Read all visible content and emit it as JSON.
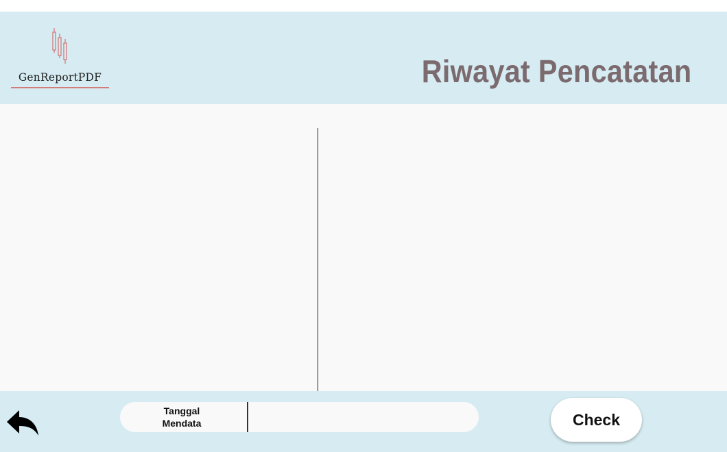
{
  "header": {
    "logo_text": "GenReportPDF",
    "logo_icon": "candlestick-chart-icon",
    "title": "Riwayat Pencatatan"
  },
  "footer": {
    "back_icon": "back-arrow-icon",
    "date_label_line1": "Tanggal",
    "date_label_line2": "Mendata",
    "date_value": "",
    "check_label": "Check"
  },
  "colors": {
    "header_bg": "#d6ecf2",
    "content_bg": "#f9f9f9",
    "title_color": "#7b6a6e",
    "logo_accent": "#d47b7b"
  }
}
